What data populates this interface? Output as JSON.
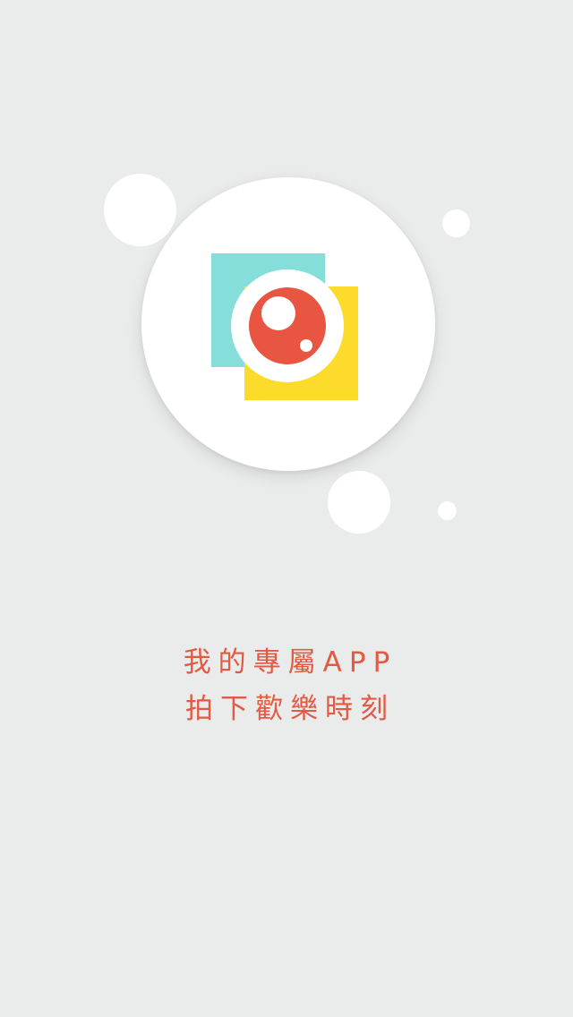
{
  "splash": {
    "tagline_line1": "我的專屬APP",
    "tagline_line2": "拍下歡樂時刻"
  },
  "logo": {
    "icon": "camera-lens-icon"
  },
  "colors": {
    "background": "#EAEBEB",
    "bubble": "#FFFFFF",
    "teal_square": "#85DEDA",
    "yellow_square": "#FCDB2B",
    "lens_red": "#E85540",
    "tagline_text": "#E25A43"
  }
}
